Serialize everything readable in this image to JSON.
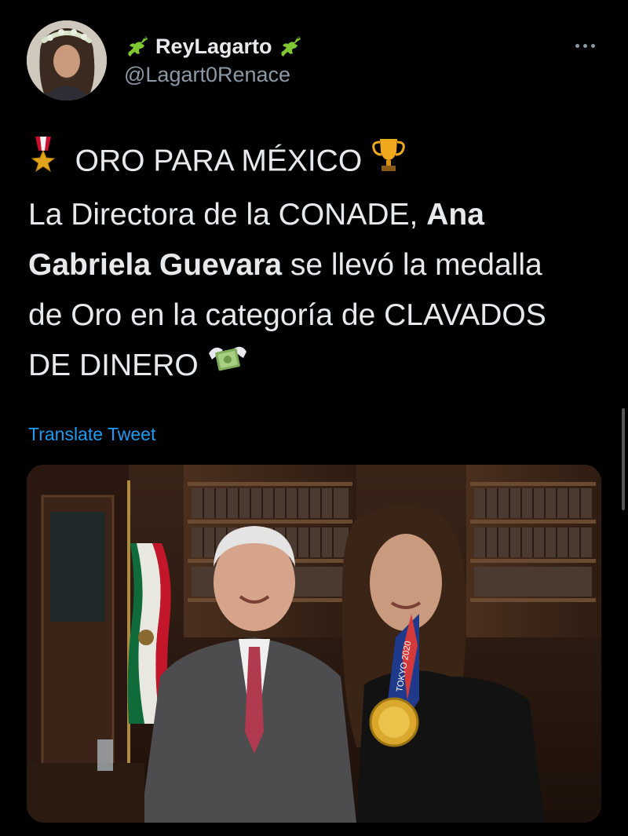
{
  "author": {
    "display_name": "ReyLagarto",
    "handle": "@Lagart0Renace"
  },
  "tweet": {
    "line1_text": "ORO PARA MÉXICO",
    "line2_text": "La Directora de la CONADE, ",
    "line2_bold": "Ana",
    "line3_bold": "Gabriela Guevara",
    "line3_text": " se llevó la medalla",
    "line4_text": "de Oro en la categoría de CLAVADOS",
    "line5_text": "DE DINERO"
  },
  "translate_label": "Translate Tweet",
  "photo": {
    "lanyard_text": "TOKYO 2020"
  },
  "icons": {
    "medal": "military-medal-icon",
    "trophy": "trophy-icon",
    "money": "money-with-wings-icon",
    "lizard": "lizard-icon",
    "more": "more-options-icon"
  },
  "colors": {
    "background": "#000000",
    "text": "#e7e9ea",
    "secondary": "#8b98a5",
    "link": "#1d9bf0"
  }
}
